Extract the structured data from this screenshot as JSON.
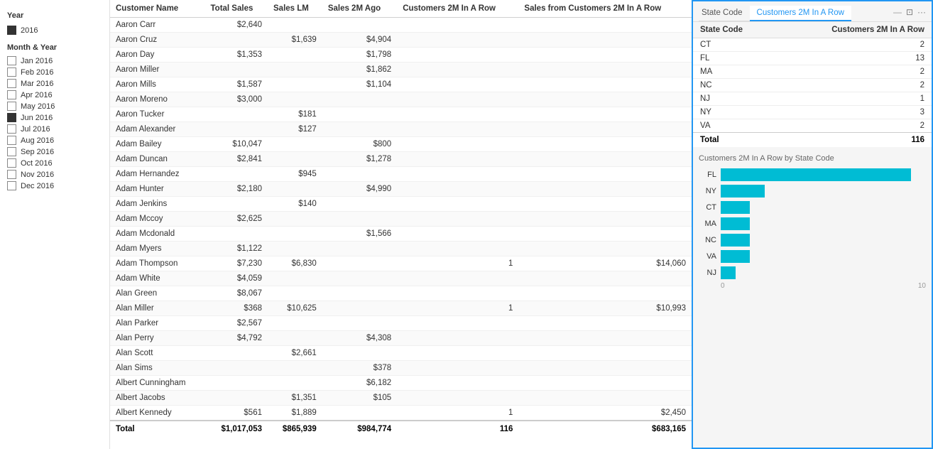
{
  "filters": {
    "year_label": "Year",
    "year_value": "2016",
    "month_label": "Month & Year",
    "months": [
      {
        "label": "Jan 2016",
        "checked": false
      },
      {
        "label": "Feb 2016",
        "checked": false
      },
      {
        "label": "Mar 2016",
        "checked": false
      },
      {
        "label": "Apr 2016",
        "checked": false
      },
      {
        "label": "May 2016",
        "checked": false
      },
      {
        "label": "Jun 2016",
        "checked": true
      },
      {
        "label": "Jul 2016",
        "checked": false
      },
      {
        "label": "Aug 2016",
        "checked": false
      },
      {
        "label": "Sep 2016",
        "checked": false
      },
      {
        "label": "Oct 2016",
        "checked": false
      },
      {
        "label": "Nov 2016",
        "checked": false
      },
      {
        "label": "Dec 2016",
        "checked": false
      }
    ]
  },
  "table": {
    "columns": [
      "Customer Name",
      "Total Sales",
      "Sales LM",
      "Sales 2M Ago",
      "Customers 2M In A Row",
      "Sales from Customers 2M In A Row"
    ],
    "rows": [
      {
        "name": "Aaron Carr",
        "total": "$2,640",
        "lm": "",
        "ago": "",
        "cust": "",
        "sfrom": ""
      },
      {
        "name": "Aaron Cruz",
        "total": "",
        "lm": "$1,639",
        "ago": "$4,904",
        "cust": "",
        "sfrom": ""
      },
      {
        "name": "Aaron Day",
        "total": "$1,353",
        "lm": "",
        "ago": "$1,798",
        "cust": "",
        "sfrom": ""
      },
      {
        "name": "Aaron Miller",
        "total": "",
        "lm": "",
        "ago": "$1,862",
        "cust": "",
        "sfrom": ""
      },
      {
        "name": "Aaron Mills",
        "total": "$1,587",
        "lm": "",
        "ago": "$1,104",
        "cust": "",
        "sfrom": ""
      },
      {
        "name": "Aaron Moreno",
        "total": "$3,000",
        "lm": "",
        "ago": "",
        "cust": "",
        "sfrom": ""
      },
      {
        "name": "Aaron Tucker",
        "total": "",
        "lm": "$181",
        "ago": "",
        "cust": "",
        "sfrom": ""
      },
      {
        "name": "Adam Alexander",
        "total": "",
        "lm": "$127",
        "ago": "",
        "cust": "",
        "sfrom": ""
      },
      {
        "name": "Adam Bailey",
        "total": "$10,047",
        "lm": "",
        "ago": "$800",
        "cust": "",
        "sfrom": ""
      },
      {
        "name": "Adam Duncan",
        "total": "$2,841",
        "lm": "",
        "ago": "$1,278",
        "cust": "",
        "sfrom": ""
      },
      {
        "name": "Adam Hernandez",
        "total": "",
        "lm": "$945",
        "ago": "",
        "cust": "",
        "sfrom": ""
      },
      {
        "name": "Adam Hunter",
        "total": "$2,180",
        "lm": "",
        "ago": "$4,990",
        "cust": "",
        "sfrom": ""
      },
      {
        "name": "Adam Jenkins",
        "total": "",
        "lm": "$140",
        "ago": "",
        "cust": "",
        "sfrom": ""
      },
      {
        "name": "Adam Mccoy",
        "total": "$2,625",
        "lm": "",
        "ago": "",
        "cust": "",
        "sfrom": ""
      },
      {
        "name": "Adam Mcdonald",
        "total": "",
        "lm": "",
        "ago": "$1,566",
        "cust": "",
        "sfrom": ""
      },
      {
        "name": "Adam Myers",
        "total": "$1,122",
        "lm": "",
        "ago": "",
        "cust": "",
        "sfrom": ""
      },
      {
        "name": "Adam Thompson",
        "total": "$7,230",
        "lm": "$6,830",
        "ago": "",
        "cust": "1",
        "sfrom": "$14,060"
      },
      {
        "name": "Adam White",
        "total": "$4,059",
        "lm": "",
        "ago": "",
        "cust": "",
        "sfrom": ""
      },
      {
        "name": "Alan Green",
        "total": "$8,067",
        "lm": "",
        "ago": "",
        "cust": "",
        "sfrom": ""
      },
      {
        "name": "Alan Miller",
        "total": "$368",
        "lm": "$10,625",
        "ago": "",
        "cust": "1",
        "sfrom": "$10,993"
      },
      {
        "name": "Alan Parker",
        "total": "$2,567",
        "lm": "",
        "ago": "",
        "cust": "",
        "sfrom": ""
      },
      {
        "name": "Alan Perry",
        "total": "$4,792",
        "lm": "",
        "ago": "$4,308",
        "cust": "",
        "sfrom": ""
      },
      {
        "name": "Alan Scott",
        "total": "",
        "lm": "$2,661",
        "ago": "",
        "cust": "",
        "sfrom": ""
      },
      {
        "name": "Alan Sims",
        "total": "",
        "lm": "",
        "ago": "$378",
        "cust": "",
        "sfrom": ""
      },
      {
        "name": "Albert Cunningham",
        "total": "",
        "lm": "",
        "ago": "$6,182",
        "cust": "",
        "sfrom": ""
      },
      {
        "name": "Albert Jacobs",
        "total": "",
        "lm": "$1,351",
        "ago": "$105",
        "cust": "",
        "sfrom": ""
      },
      {
        "name": "Albert Kennedy",
        "total": "$561",
        "lm": "$1,889",
        "ago": "",
        "cust": "1",
        "sfrom": "$2,450"
      }
    ],
    "footer": {
      "label": "Total",
      "total": "$1,017,053",
      "lm": "$865,939",
      "ago": "$984,774",
      "cust": "116",
      "sfrom": "$683,165"
    }
  },
  "right_panel": {
    "tab_state": "Customers 2M In A Row",
    "tab_state_code": "State Code",
    "header_icons": [
      "—",
      "⊡",
      "..."
    ],
    "table": {
      "columns": [
        "State Code",
        "Customers 2M In A Row"
      ],
      "rows": [
        {
          "state": "CT",
          "count": "2"
        },
        {
          "state": "FL",
          "count": "13"
        },
        {
          "state": "MA",
          "count": "2"
        },
        {
          "state": "NC",
          "count": "2"
        },
        {
          "state": "NJ",
          "count": "1"
        },
        {
          "state": "NY",
          "count": "3"
        },
        {
          "state": "VA",
          "count": "2"
        }
      ],
      "footer": {
        "label": "Total",
        "count": "116"
      }
    },
    "chart": {
      "title": "Customers 2M In A Row by State Code",
      "bars": [
        {
          "label": "FL",
          "value": 13,
          "max": 14
        },
        {
          "label": "NY",
          "value": 3,
          "max": 14
        },
        {
          "label": "CT",
          "value": 2,
          "max": 14
        },
        {
          "label": "MA",
          "value": 2,
          "max": 14
        },
        {
          "label": "NC",
          "value": 2,
          "max": 14
        },
        {
          "label": "VA",
          "value": 2,
          "max": 14
        },
        {
          "label": "NJ",
          "value": 1,
          "max": 14
        }
      ],
      "axis_min": "0",
      "axis_max": "10"
    }
  }
}
